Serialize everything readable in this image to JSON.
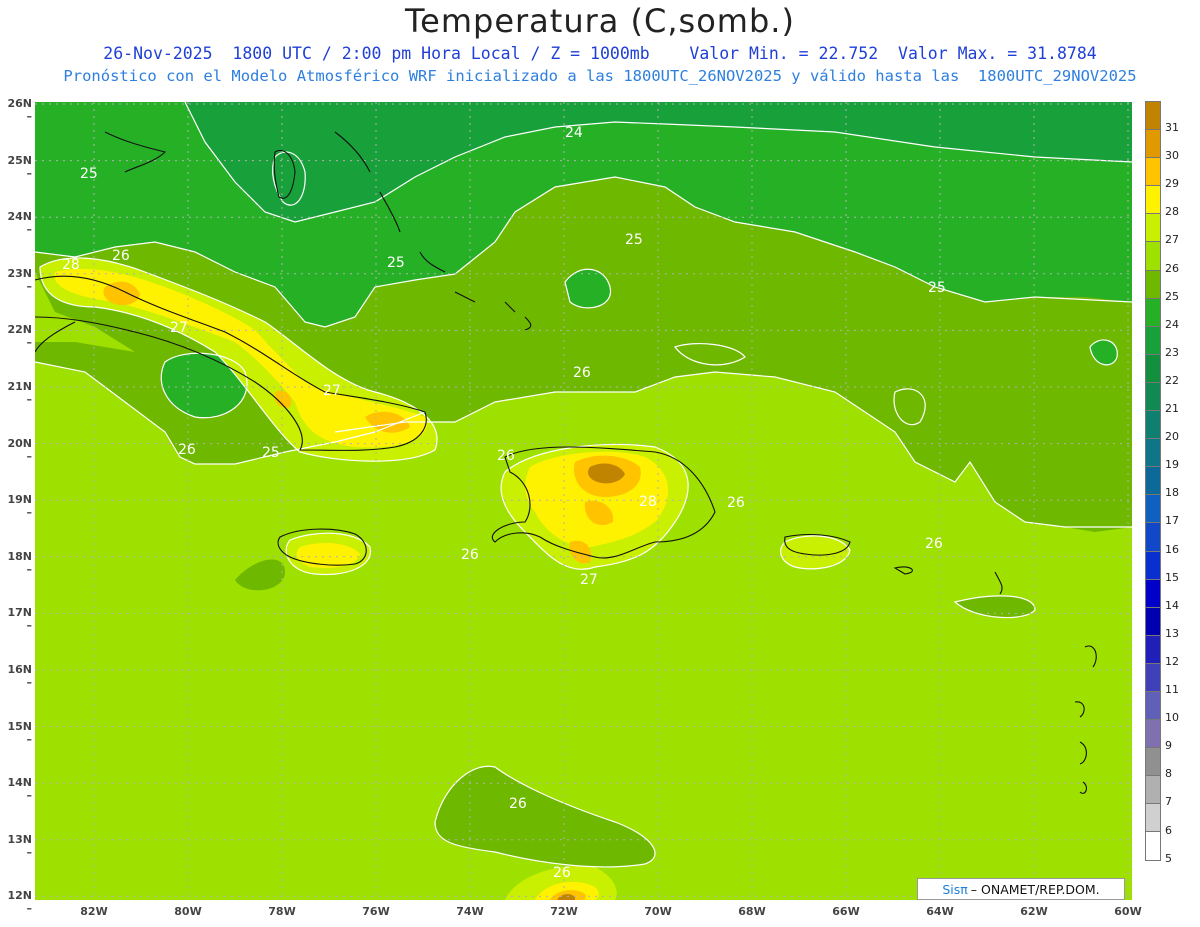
{
  "header": {
    "title": "Temperatura (C,somb.)",
    "line1": "26-Nov-2025  1800 UTC / 2:00 pm Hora Local / Z = 1000mb    Valor Min. = 22.752  Valor Max. = 31.8784",
    "line2": "Pronóstico con el Modelo Atmosférico WRF inicializado a las 1800UTC_26NOV2025 y válido hasta las  1800UTC_29NOV2025"
  },
  "axes": {
    "lat_labels": [
      "26N",
      "25N",
      "24N",
      "23N",
      "22N",
      "21N",
      "20N",
      "19N",
      "18N",
      "17N",
      "16N",
      "15N",
      "14N",
      "13N",
      "12N"
    ],
    "lon_labels": [
      "82W",
      "80W",
      "78W",
      "76W",
      "74W",
      "72W",
      "70W",
      "68W",
      "66W",
      "64W",
      "62W",
      "60W"
    ]
  },
  "colorbar": {
    "labels": [
      "31",
      "30",
      "29",
      "28",
      "27",
      "26",
      "25",
      "24",
      "23",
      "22",
      "21",
      "20",
      "19",
      "18",
      "17",
      "16",
      "15",
      "14",
      "13",
      "12",
      "11",
      "10",
      "9",
      "8",
      "7",
      "6",
      "5"
    ],
    "colors": [
      "#c08400",
      "#e09a00",
      "#ffc300",
      "#fff200",
      "#c8f000",
      "#9ee000",
      "#6fb800",
      "#26b026",
      "#18a03a",
      "#12903e",
      "#108a52",
      "#0f8070",
      "#0f7688",
      "#0d6a98",
      "#1060c0",
      "#1048c8",
      "#0a2fd0",
      "#0000c8",
      "#0000b0",
      "#2020b8",
      "#4040b8",
      "#6060b8",
      "#8070b0",
      "#909090",
      "#b0b0b0",
      "#d0d0d0",
      "#ffffff"
    ]
  },
  "map": {
    "contour_labels": [
      "24",
      "25",
      "25",
      "25",
      "25",
      "25",
      "26",
      "26",
      "26",
      "26",
      "26",
      "26",
      "26",
      "26",
      "27",
      "27",
      "27",
      "28",
      "28"
    ]
  },
  "footer": {
    "brand": "Sisπ",
    "org": "– ONAMET/REP.DOM."
  }
}
